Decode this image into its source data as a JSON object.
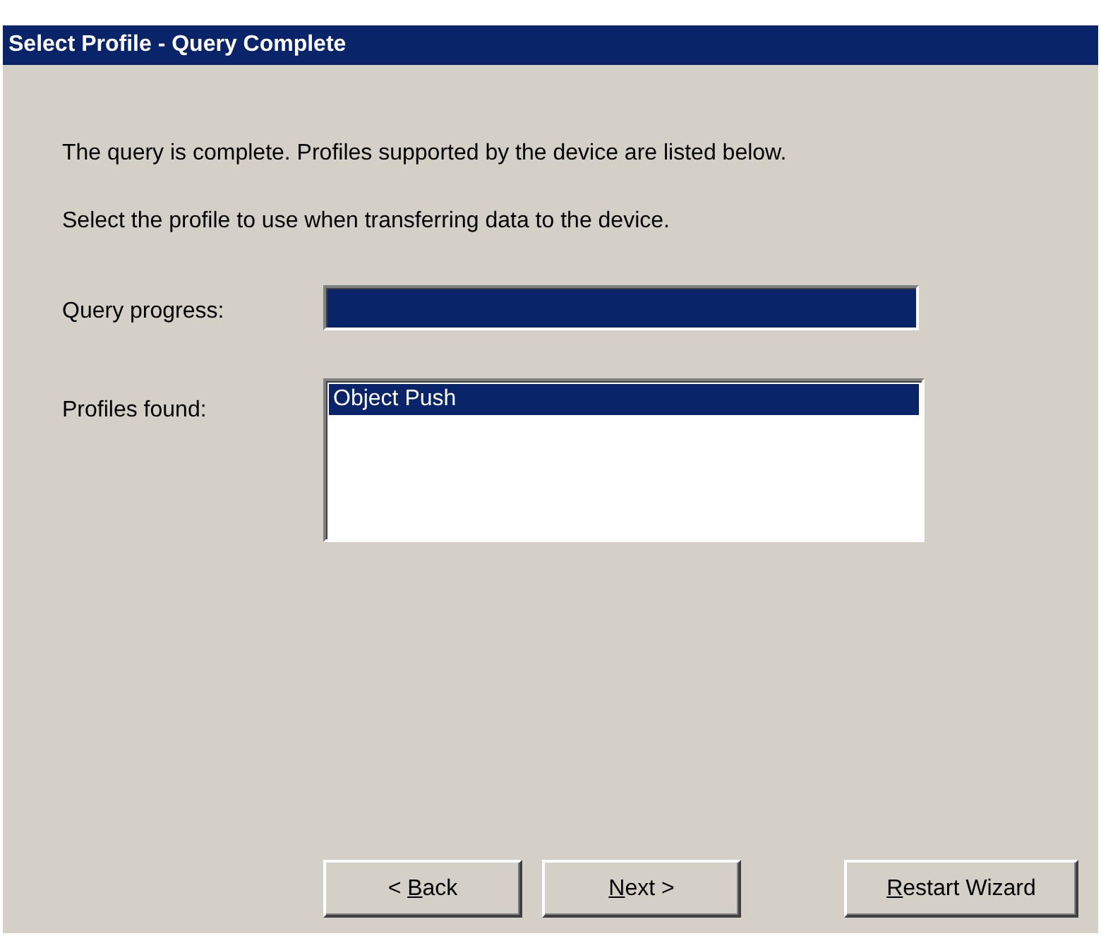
{
  "window": {
    "title": "Select Profile - Query Complete"
  },
  "intro": [
    "The query is complete. Profiles supported by the device are listed below.",
    "Select the profile to use when transferring data to the device."
  ],
  "progress": {
    "label": "Query progress:",
    "level": 1
  },
  "profiles": {
    "label": "Profiles found:",
    "items": [
      {
        "text": "Object Push",
        "selected": true
      }
    ]
  },
  "buttons": [
    {
      "before": "< ",
      "key": "B",
      "after": "ack"
    },
    {
      "key": "N",
      "after": "ext >"
    },
    {
      "key": "R",
      "after": "estart Wizard"
    }
  ]
}
